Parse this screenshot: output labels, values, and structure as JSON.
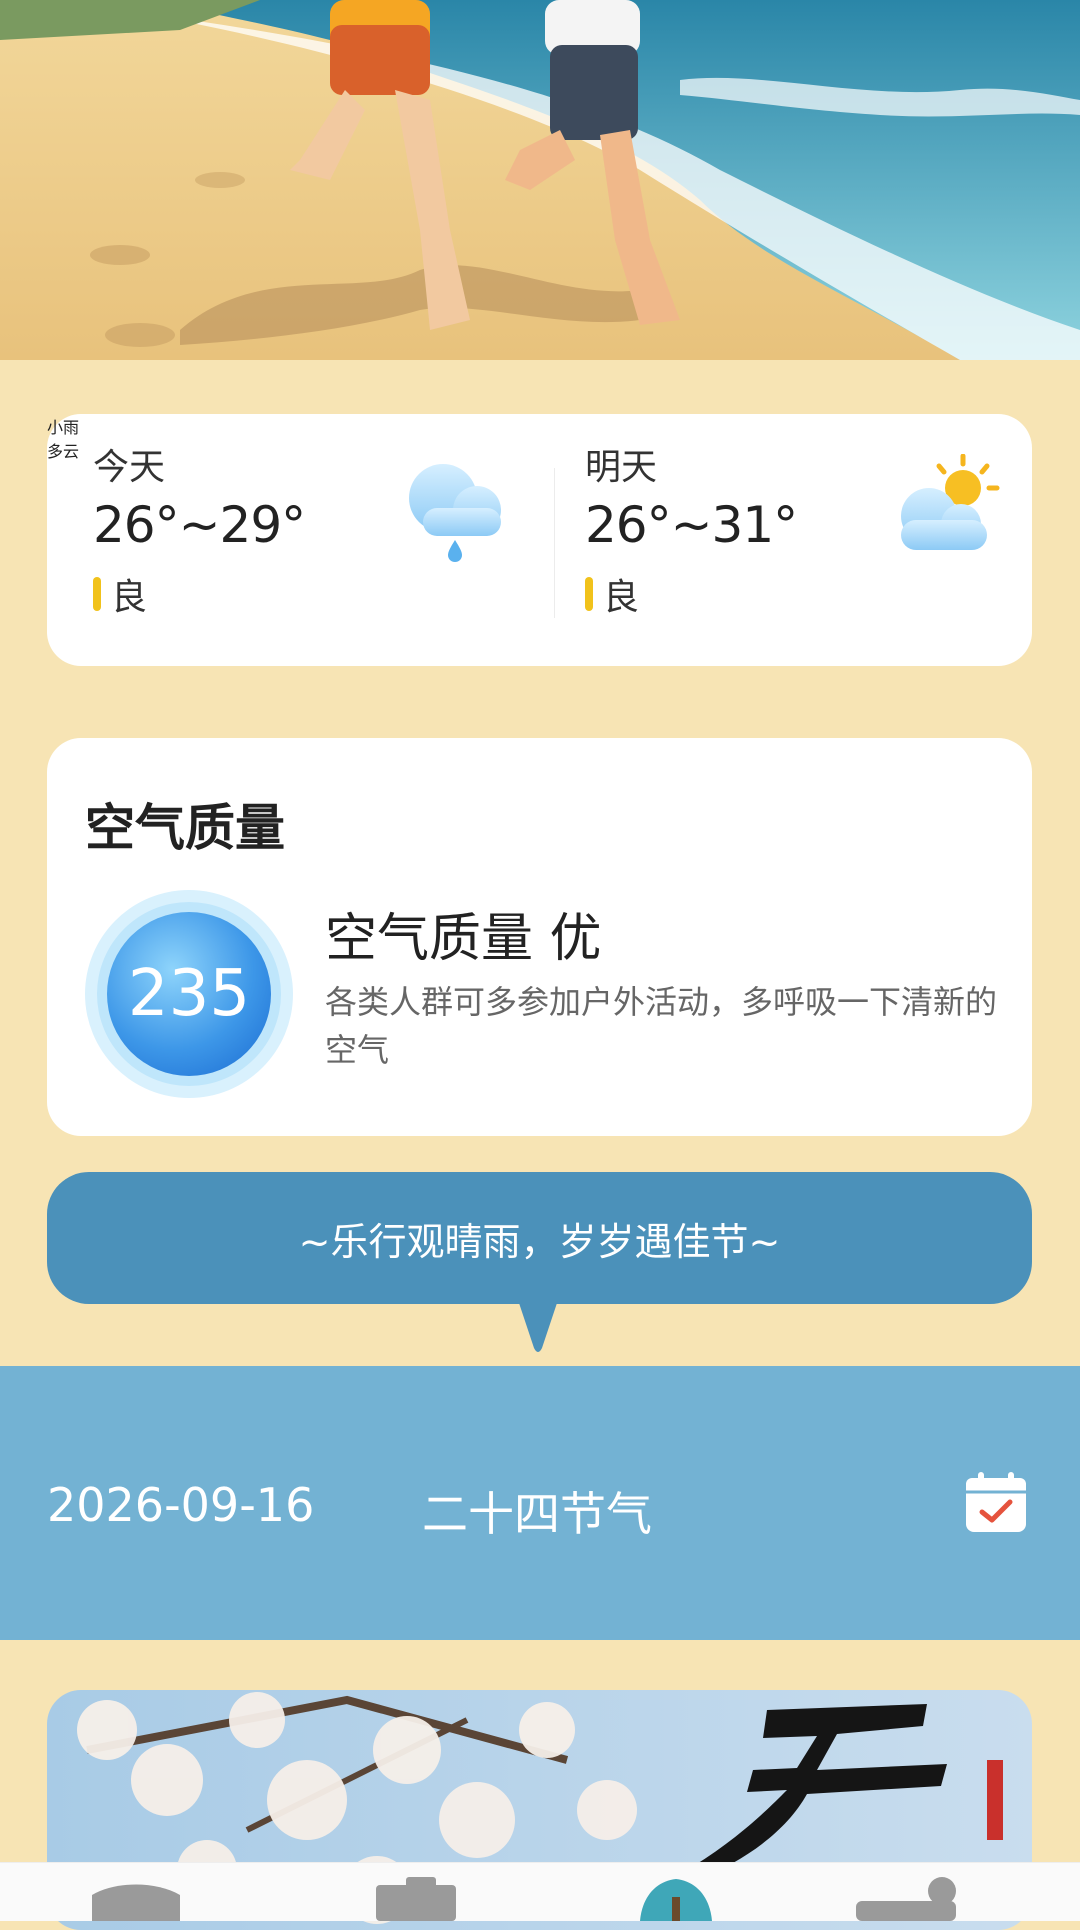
{
  "hero": {
    "image": "beach-running-illustration"
  },
  "weather": {
    "today": {
      "label": "今天",
      "temp": "26°~29°",
      "aq": "良",
      "condition": "小雨",
      "icon": "rain-cloud-icon"
    },
    "tomorrow": {
      "label": "明天",
      "temp": "26°~31°",
      "aq": "良",
      "condition": "多云",
      "icon": "sun-cloud-icon"
    },
    "aq_color": "#f1c21b"
  },
  "air_quality": {
    "title": "空气质量",
    "aqi": "235",
    "status": "空气质量 优",
    "description": "各类人群可多参加户外活动，多呼吸一下清新的空气"
  },
  "slogan": {
    "text": "~乐行观晴雨，岁岁遇佳节~",
    "color": "#4b91ba"
  },
  "solar_term": {
    "date": "2026-09-16",
    "name": "二十四节气",
    "icon": "calendar-check-icon",
    "band_color": "#73b2d3"
  },
  "photo_card": {
    "image": "blossom-calligraphy-image"
  },
  "tabbar": {
    "tabs": [
      "home-tab-icon",
      "tools-tab-icon",
      "tree-tab-icon",
      "profile-tab-icon"
    ]
  }
}
